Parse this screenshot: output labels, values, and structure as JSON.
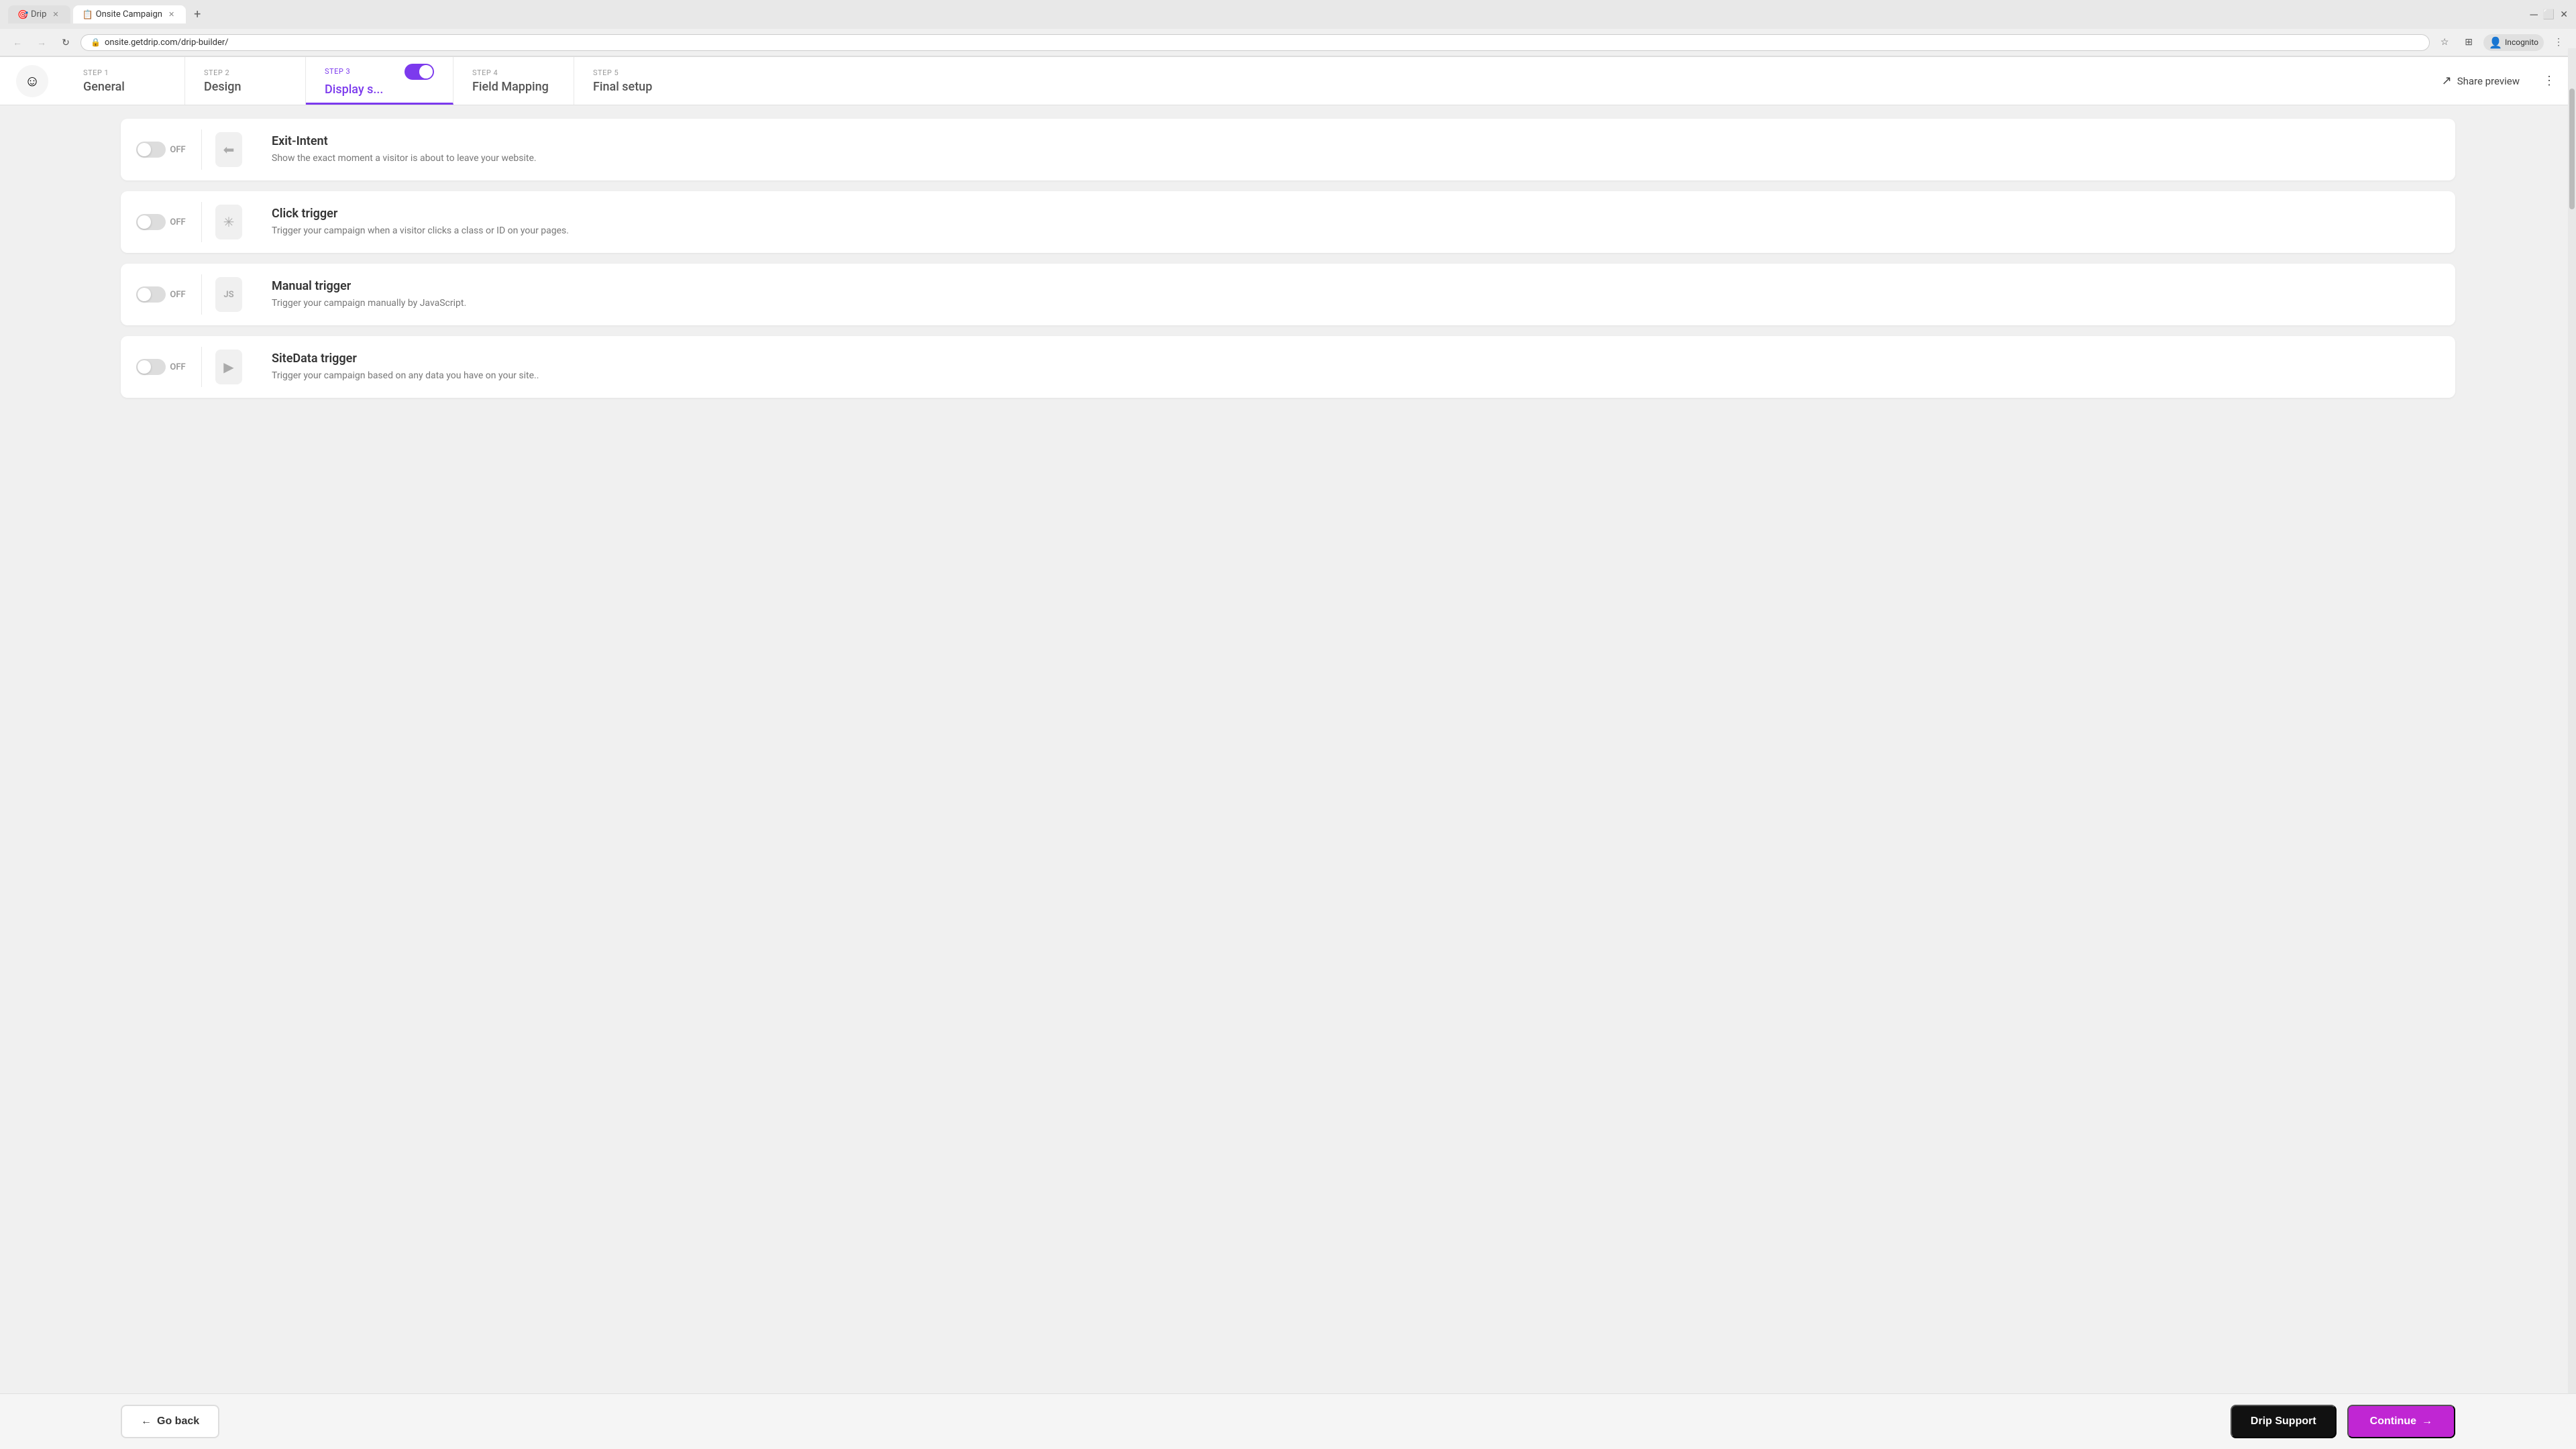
{
  "browser": {
    "tabs": [
      {
        "id": "drip",
        "label": "Drip",
        "favicon": "🎯",
        "active": false
      },
      {
        "id": "onsite",
        "label": "Onsite Campaign",
        "favicon": "📋",
        "active": true
      }
    ],
    "new_tab_label": "+",
    "url": "onsite.getdrip.com/drip-builder/",
    "nav": {
      "back_disabled": true,
      "forward_disabled": true,
      "refresh": "↻"
    },
    "right_icons": {
      "star": "☆",
      "extensions": "⊞",
      "incognito": "Incognito",
      "menu": "⋮"
    }
  },
  "steps": [
    {
      "id": "step1",
      "label": "STEP 1",
      "name": "General",
      "active": false
    },
    {
      "id": "step2",
      "label": "STEP 2",
      "name": "Design",
      "active": false
    },
    {
      "id": "step3",
      "label": "STEP 3",
      "name": "Display s...",
      "active": true,
      "has_toggle": true
    },
    {
      "id": "step4",
      "label": "STEP 4",
      "name": "Field Mapping",
      "active": false
    },
    {
      "id": "step5",
      "label": "STEP 5",
      "name": "Final setup",
      "active": false
    }
  ],
  "header": {
    "share_preview_label": "Share preview",
    "more_label": "⋮"
  },
  "logo": "☺",
  "triggers": [
    {
      "id": "exit-intent",
      "toggle_state": "OFF",
      "title": "Exit-Intent",
      "description": "Show the exact moment a visitor is about to leave your website.",
      "icon": "⬅"
    },
    {
      "id": "click-trigger",
      "toggle_state": "OFF",
      "title": "Click trigger",
      "description": "Trigger your campaign when a visitor clicks a class or ID on your pages.",
      "icon": "✳"
    },
    {
      "id": "manual-trigger",
      "toggle_state": "OFF",
      "title": "Manual trigger",
      "description": "Trigger your campaign manually by JavaScript.",
      "icon": "JS"
    },
    {
      "id": "sitedata-trigger",
      "toggle_state": "OFF",
      "title": "SiteData trigger",
      "description": "Trigger your campaign based on any data you have on your site..",
      "icon": "▶"
    }
  ],
  "bottom": {
    "go_back": "← Go back",
    "drip_support": "Drip Support",
    "continue": "Continue →"
  }
}
